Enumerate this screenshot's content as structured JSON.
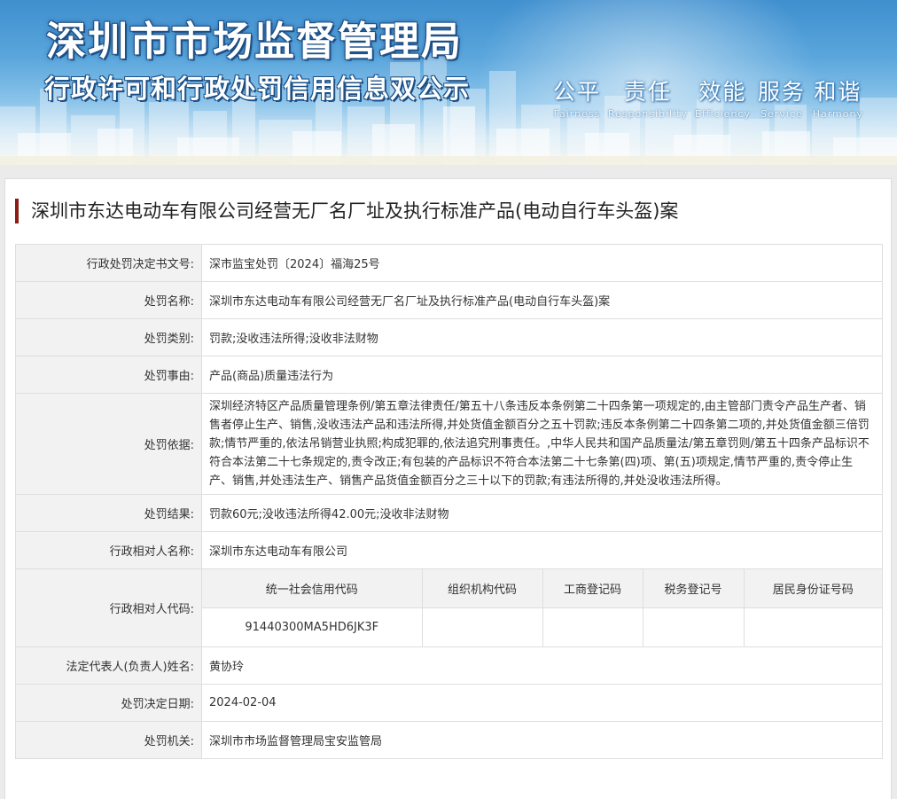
{
  "banner": {
    "title": "深圳市市场监督管理局",
    "subtitle": "行政许可和行政处罚信用信息双公示",
    "slogans": [
      {
        "cn": "公平",
        "en": "Fairness"
      },
      {
        "cn": "责任",
        "en": "Responsibility"
      },
      {
        "cn": "效能",
        "en": "Efficiency"
      },
      {
        "cn": "服务",
        "en": "Service"
      },
      {
        "cn": "和谐",
        "en": "Harmony"
      }
    ]
  },
  "case": {
    "title": "深圳市东达电动车有限公司经营无厂名厂址及执行标准产品(电动自行车头盔)案",
    "rows": {
      "doc_no": {
        "label": "行政处罚决定书文号:",
        "value": "深市监宝处罚〔2024〕福海25号"
      },
      "name": {
        "label": "处罚名称:",
        "value": "深圳市东达电动车有限公司经营无厂名厂址及执行标准产品(电动自行车头盔)案"
      },
      "category": {
        "label": "处罚类别:",
        "value": "罚款;没收违法所得;没收非法财物"
      },
      "reason": {
        "label": "处罚事由:",
        "value": "产品(商品)质量违法行为"
      },
      "basis": {
        "label": "处罚依据:",
        "value": "深圳经济特区产品质量管理条例/第五章法律责任/第五十八条违反本条例第二十四条第一项规定的,由主管部门责令产品生产者、销售者停止生产、销售,没收违法产品和违法所得,并处货值金额百分之五十罚款;违反本条例第二十四条第二项的,并处货值金额三倍罚款;情节严重的,依法吊销营业执照;构成犯罪的,依法追究刑事责任。,中华人民共和国产品质量法/第五章罚则/第五十四条产品标识不符合本法第二十七条规定的,责令改正;有包装的产品标识不符合本法第二十七条第(四)项、第(五)项规定,情节严重的,责令停止生产、销售,并处违法生产、销售产品货值金额百分之三十以下的罚款;有违法所得的,并处没收违法所得。"
      },
      "result": {
        "label": "处罚结果:",
        "value": "罚款60元;没收违法所得42.00元;没收非法财物"
      },
      "party": {
        "label": "行政相对人名称:",
        "value": "深圳市东达电动车有限公司"
      },
      "party_code": {
        "label": "行政相对人代码:",
        "headers": [
          "统一社会信用代码",
          "组织机构代码",
          "工商登记码",
          "税务登记号",
          "居民身份证号码"
        ],
        "values": [
          "91440300MA5HD6JK3F",
          "",
          "",
          "",
          ""
        ]
      },
      "legal_rep": {
        "label": "法定代表人(负责人)姓名:",
        "value": "黄协玲"
      },
      "date": {
        "label": "处罚决定日期:",
        "value": "2024-02-04"
      },
      "authority": {
        "label": "处罚机关:",
        "value": "深圳市市场监督管理局宝安监管局"
      }
    }
  }
}
